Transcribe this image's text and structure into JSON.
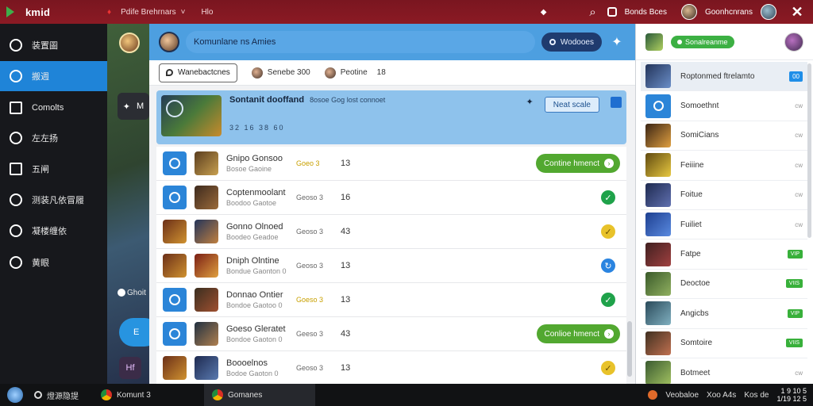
{
  "topbar": {
    "brand": "kmid",
    "tag": "♦",
    "search": "Pdife Brehrnars",
    "search_caret": "˅",
    "search_extra": "Hlo",
    "right_icon": "◆",
    "search_icon": "⌕",
    "notif_label": "Bonds Bces",
    "user_name": "Goonhcnrans",
    "close": "✕"
  },
  "sidebar": {
    "items": [
      {
        "label": "装置圖",
        "icon": "globe-icon",
        "active": false
      },
      {
        "label": "搬週",
        "icon": "compass-icon",
        "active": true
      },
      {
        "label": "Comolts",
        "icon": "window-icon",
        "active": false
      },
      {
        "label": "左左扬",
        "icon": "chart-icon",
        "active": false
      },
      {
        "label": "五闸",
        "icon": "panel-icon",
        "active": false
      },
      {
        "label": "测装凡依冒履",
        "icon": "pen-icon",
        "active": false
      },
      {
        "label": "凝楼缠依",
        "icon": "clock-icon",
        "active": false
      },
      {
        "label": "黄眼",
        "icon": "tool-icon",
        "active": false
      }
    ]
  },
  "background": {
    "chip_icon": "✦",
    "chip_label": "M",
    "chip2": "Ghoit",
    "pill": "E",
    "sq": "Hf"
  },
  "panel": {
    "title": "Komunlane ns Amies",
    "header_button": "Wodooes",
    "spark": "✦",
    "filters": {
      "search": "Wanebactcnes",
      "chip1": "Senebe 300",
      "chip2": "Peotine",
      "chip2_num": "18"
    },
    "featured": {
      "title": "Sontanit dooffand",
      "subtitle": "8osoe Gog lost connoet",
      "meta": "32 16 38 60",
      "star": "✦",
      "action": "Neat scale"
    },
    "rows": [
      {
        "name": "Gnipo Gonsoo",
        "sub": "Bosoe Gaoine",
        "cost": "Goeo 3",
        "num": "13",
        "status": "cta",
        "cta": "Contine hmenct",
        "cost_gold": true
      },
      {
        "name": "Coptenmoolant",
        "sub": "Boodoo Gaotoe",
        "cost": "Geoso 3",
        "num": "16",
        "status": "green"
      },
      {
        "name": "Gonno Olnoed",
        "sub": "Boodeo Geadoe",
        "cost": "Geoso 3",
        "num": "43",
        "status": "gold"
      },
      {
        "name": "Dniph Olntine",
        "sub": "Bondue Gaonton 0",
        "cost": "Geoso 3",
        "num": "13",
        "status": "blue"
      },
      {
        "name": "Donnao Ontier",
        "sub": "Bondoe Gaotoo 0",
        "cost": "Goeso 3",
        "num": "13",
        "status": "green",
        "cost_gold": true
      },
      {
        "name": "Goeso Gleratet",
        "sub": "Bondoe Gaoton 0",
        "cost": "Geeso 3",
        "num": "43",
        "status": "cta",
        "cta": "Conlioe hmenct"
      },
      {
        "name": "Boooelnos",
        "sub": "Bodoe Gaoton 0",
        "cost": "Geoso 3",
        "num": "13",
        "status": "gold"
      }
    ]
  },
  "right": {
    "badge": "Sonalreanme",
    "items": [
      {
        "name": "Roptonmed ftrelamto",
        "tag": "00",
        "tag_type": "b",
        "sel": true
      },
      {
        "name": "Somoethnt",
        "tag": "cw",
        "tag_type": "n"
      },
      {
        "name": "SomiCians",
        "tag": "cw",
        "tag_type": "n"
      },
      {
        "name": "Feiiine",
        "tag": "cw",
        "tag_type": "n"
      },
      {
        "name": "Foitue",
        "tag": "cw",
        "tag_type": "n"
      },
      {
        "name": "Fuiliet",
        "tag": "cw",
        "tag_type": "n"
      },
      {
        "name": "Fatpe",
        "tag": "VIP",
        "tag_type": "g"
      },
      {
        "name": "Deoctoe",
        "tag": "VIIS",
        "tag_type": "g"
      },
      {
        "name": "Angicbs",
        "tag": "VIP",
        "tag_type": "g"
      },
      {
        "name": "Somtoire",
        "tag": "VIIS",
        "tag_type": "g"
      },
      {
        "name": "Botmeet",
        "tag": "cw",
        "tag_type": "n"
      }
    ]
  },
  "taskbar": {
    "start_label": "燈源隐提",
    "tasks": [
      {
        "label": "Komunt 3",
        "active": false
      },
      {
        "label": "Gomanes",
        "active": true
      }
    ],
    "tray1": "Veobaloe",
    "tray2": "Xoo A4s",
    "tray3": "Kos de",
    "clock_time": "1 9 10 5",
    "clock_date": "1/19 12 5"
  }
}
